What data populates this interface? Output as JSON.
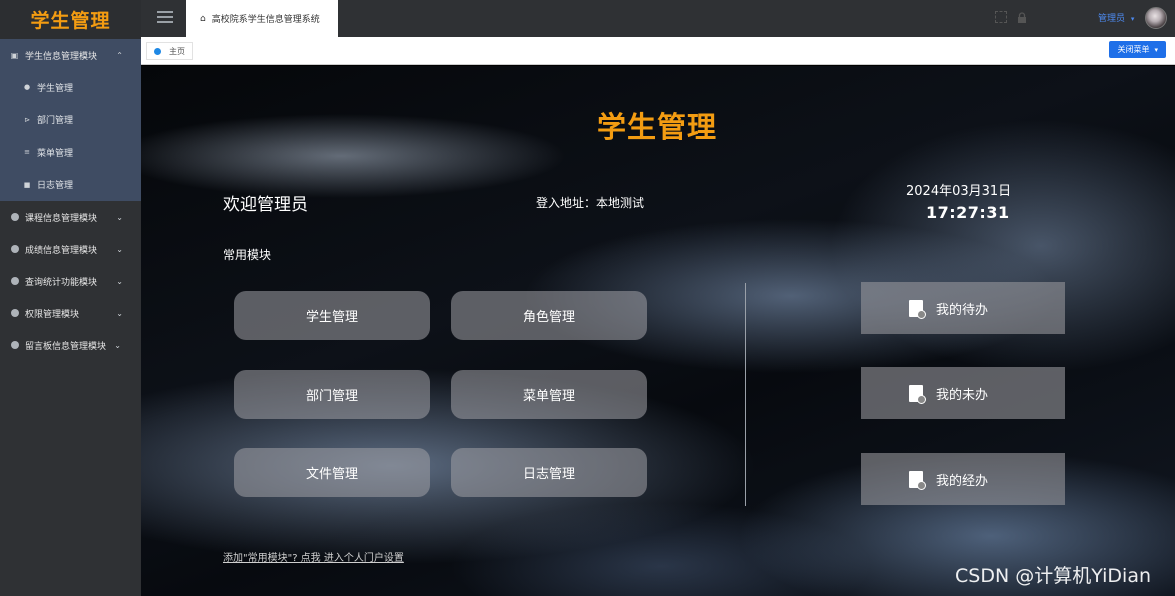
{
  "app": {
    "logo": "学生管理",
    "title": "高校院系学生信息管理系统"
  },
  "sidebar": {
    "groups": [
      {
        "label": "学生信息管理模块",
        "expanded": true,
        "items": [
          {
            "label": "学生管理"
          },
          {
            "label": "部门管理"
          },
          {
            "label": "菜单管理"
          },
          {
            "label": "日志管理"
          }
        ]
      },
      {
        "label": "课程信息管理模块"
      },
      {
        "label": "成绩信息管理模块"
      },
      {
        "label": "查询统计功能模块"
      },
      {
        "label": "权限管理模块"
      },
      {
        "label": "留言板信息管理模块"
      }
    ]
  },
  "topbar": {
    "home_tab": "高校院系学生信息管理系统",
    "user": "管理员"
  },
  "tabs": {
    "main": "主页",
    "close_menu": "关闭菜单"
  },
  "main": {
    "brand": "学生管理",
    "welcome": "欢迎管理员",
    "login_address": "登入地址：本地测试",
    "date": "2024年03月31日",
    "time": "17:27:31",
    "common_label": "常用模块",
    "modules": [
      "学生管理",
      "角色管理",
      "部门管理",
      "菜单管理",
      "文件管理",
      "日志管理"
    ],
    "tasks": [
      "我的待办",
      "我的未办",
      "我的经办"
    ],
    "portal_link": "添加\"常用模块\"? 点我 进入个人门户设置",
    "watermark": "CSDN @计算机YiDian"
  },
  "colors": {
    "brand": "#f39c12",
    "accent": "#1e6fe8",
    "sidebar_bg": "#2f3134",
    "sidebar_active": "#3f4c63"
  }
}
